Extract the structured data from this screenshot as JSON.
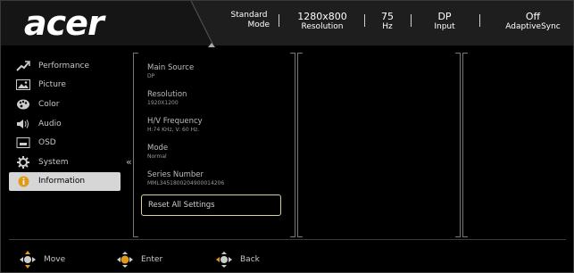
{
  "header": {
    "logo": "acer",
    "stats": [
      {
        "value": "Standard",
        "label": "Mode"
      },
      {
        "value": "1280x800",
        "label": "Resolution"
      },
      {
        "value": "75",
        "label": "Hz"
      },
      {
        "value": "DP",
        "label": "Input"
      },
      {
        "value": "Off",
        "label": "AdaptiveSync"
      }
    ]
  },
  "sidebar": {
    "items": [
      {
        "label": "Performance",
        "icon": "performance-icon"
      },
      {
        "label": "Picture",
        "icon": "picture-icon"
      },
      {
        "label": "Color",
        "icon": "color-palette-icon"
      },
      {
        "label": "Audio",
        "icon": "speaker-icon"
      },
      {
        "label": "OSD",
        "icon": "osd-screen-icon"
      },
      {
        "label": "System",
        "icon": "gear-icon"
      },
      {
        "label": "Information",
        "icon": "info-icon",
        "active": true
      }
    ]
  },
  "info": {
    "items": [
      {
        "label": "Main Source",
        "value": "DP"
      },
      {
        "label": "Resolution",
        "value": "1920X1200"
      },
      {
        "label": "H/V Frequency",
        "value": "H:74 KHz, V: 60 Hz."
      },
      {
        "label": "Mode",
        "value": "Normal"
      },
      {
        "label": "Series Number",
        "value": "MML3451800204900014206"
      }
    ],
    "reset_label": "Reset All Settings"
  },
  "footer": {
    "move": "Move",
    "enter": "Enter",
    "back": "Back"
  },
  "colors": {
    "background": "#000000",
    "header_bar": "#1e1e1e",
    "active_item": "#d6d6d6",
    "reset_border": "#d7cf9e"
  }
}
